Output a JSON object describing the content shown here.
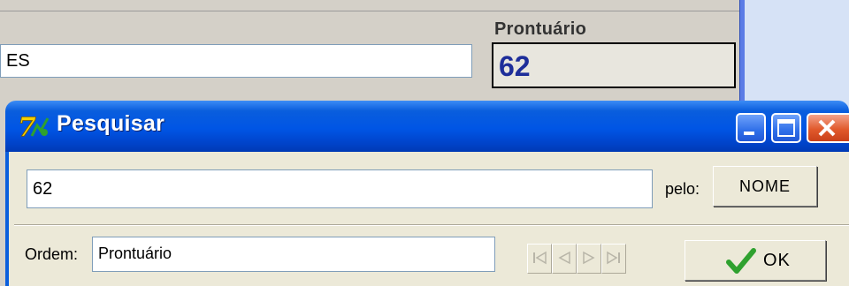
{
  "parent": {
    "name_value": "ES",
    "prontuario_label": "Prontuário",
    "prontuario_value": "62",
    "partial_label": "– – – –  – – –  – – – – – –"
  },
  "dialog": {
    "title": "Pesquisar",
    "app_icon": "7-logo-icon",
    "search_value": "62",
    "pelo_label": "pelo:",
    "nome_button": "NOME",
    "ordem_label": "Ordem:",
    "ordem_value": "Prontuário",
    "nav": {
      "first": "⏮",
      "prev": "◁",
      "next": "▷",
      "last": "⏭"
    },
    "ok_label": "OK"
  },
  "colors": {
    "titlebar": "#0055E5",
    "prontuario_value": "#1E2E9A",
    "close_button": "#E15A2C",
    "ok_check": "#2FA12F"
  }
}
